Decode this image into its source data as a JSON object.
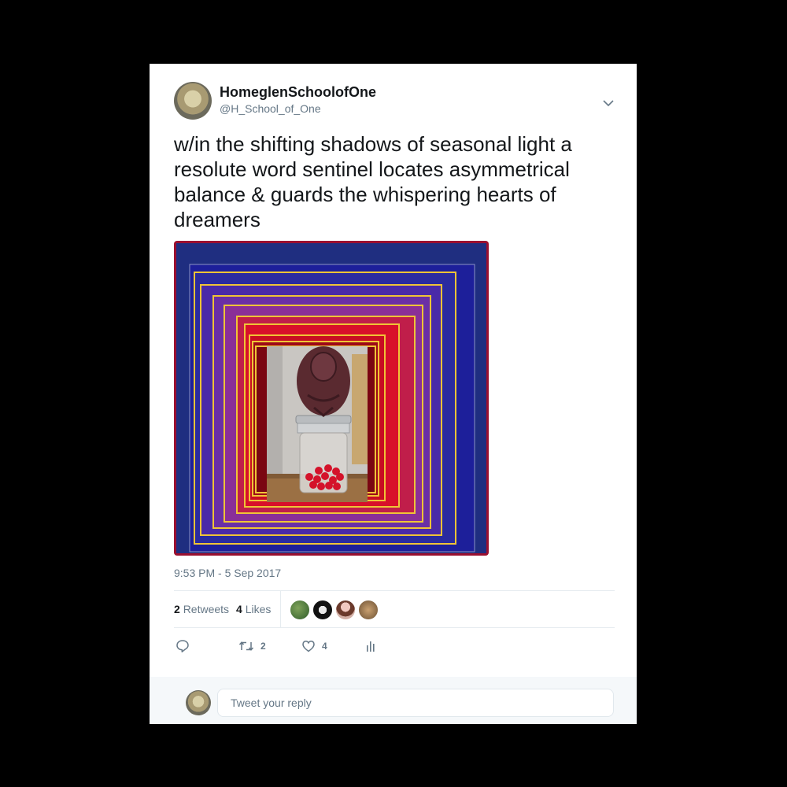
{
  "tweet": {
    "display_name": "HomeglenSchoolofOne",
    "handle": "@H_School_of_One",
    "text": "w/in the shifting shadows of seasonal light a resolute word sentinel locates asymmetrical balance & guards the whispering hearts of dreamers",
    "timestamp": "9:53 PM - 5 Sep 2017"
  },
  "stats": {
    "retweets_count": "2",
    "retweets_label": "Retweets",
    "likes_count": "4",
    "likes_label": "Likes"
  },
  "actions": {
    "retweet_count": "2",
    "like_count": "4"
  },
  "reply": {
    "placeholder": "Tweet your reply"
  },
  "colors": {
    "text": "#14171a",
    "secondary": "#657786",
    "divider": "#e6ecf0",
    "frame_navy": "#1c2a8c",
    "frame_red": "#d0102a",
    "frame_purple": "#6a2d9a",
    "frame_gold": "#f2c531"
  }
}
